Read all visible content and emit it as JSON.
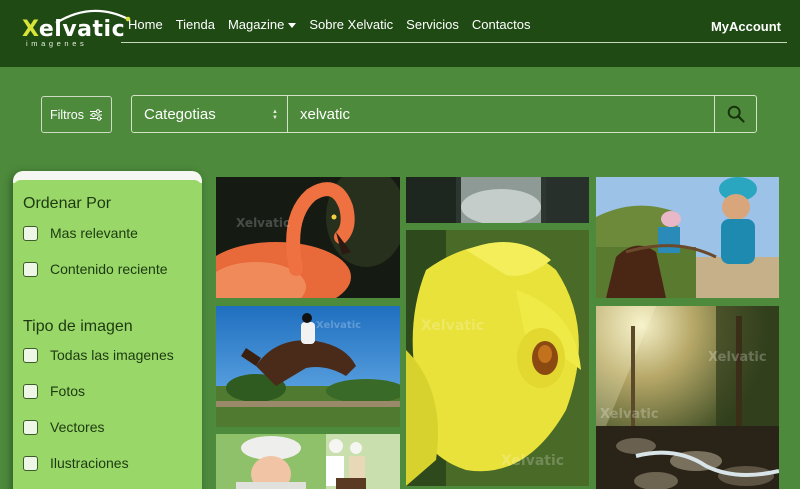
{
  "brand": {
    "name_first": "X",
    "name_rest": "elvatic",
    "tagline": "imagenes"
  },
  "nav": {
    "items": [
      "Home",
      "Tienda",
      "Magazine",
      "Sobre Xelvatic",
      "Servicios",
      "Contactos"
    ],
    "account": "MyAccount"
  },
  "search": {
    "filters_label": "Filtros",
    "category_selected": "Categotias",
    "query": "xelvatic"
  },
  "sidebar": {
    "sort_title": "Ordenar Por",
    "sort_options": [
      "Mas relevante",
      "Contenido reciente"
    ],
    "type_title": "Tipo de imagen",
    "type_options": [
      "Todas las imagenes",
      "Fotos",
      "Vectores",
      "Ilustraciones"
    ]
  },
  "gallery": {
    "watermark": "Xelvatic"
  },
  "colors": {
    "header_bg": "#1f4a14",
    "page_bg": "#4d8a3c",
    "sidebar_bg": "#9ad769",
    "logo_accent": "#d8e43a"
  },
  "icons": [
    "sliders-icon",
    "search-icon",
    "chevron-down-icon",
    "select-arrows-icon"
  ]
}
